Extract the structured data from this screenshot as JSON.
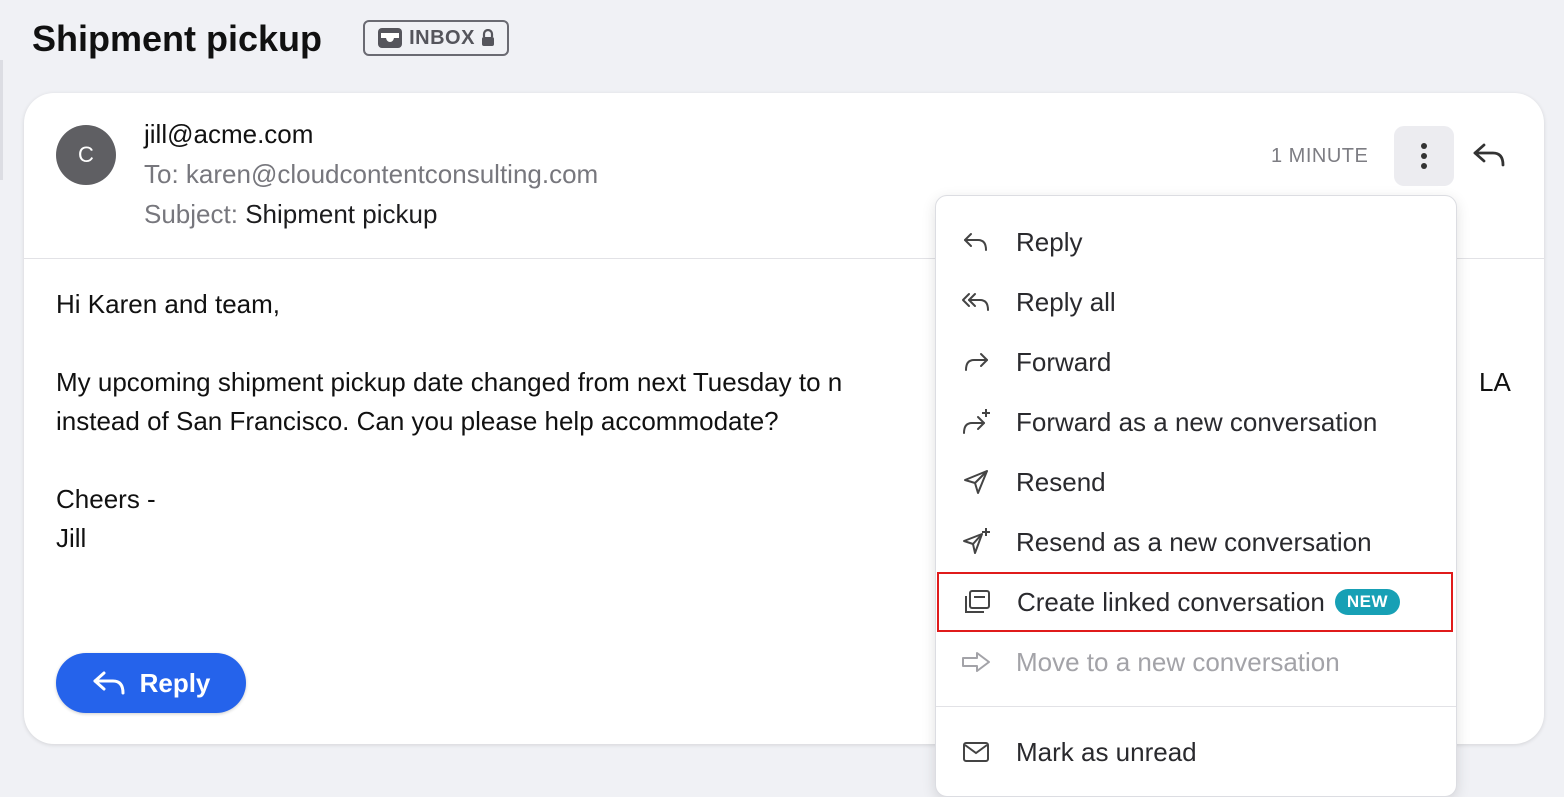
{
  "page": {
    "title": "Shipment pickup",
    "inbox_badge": "INBOX"
  },
  "message": {
    "avatar_initial": "C",
    "sender": "jill@acme.com",
    "to_label": "To:",
    "to_value": "karen@cloudcontentconsulting.com",
    "subject_label": "Subject:",
    "subject_value": "Shipment pickup",
    "timestamp": "1 MINUTE",
    "body": {
      "greeting": "Hi Karen and team,",
      "line1_part": "My upcoming shipment pickup date changed from next Tuesday to n",
      "line1_tail": "LA",
      "line2": "instead of San Francisco. Can you please help accommodate?",
      "sign1": "Cheers -",
      "sign2": "Jill"
    },
    "reply_button_label": "Reply"
  },
  "menu": {
    "items": [
      {
        "label": "Reply",
        "icon": "reply-icon"
      },
      {
        "label": "Reply all",
        "icon": "reply-all-icon"
      },
      {
        "label": "Forward",
        "icon": "forward-icon"
      },
      {
        "label": "Forward as a new conversation",
        "icon": "forward-new-icon"
      },
      {
        "label": "Resend",
        "icon": "send-icon"
      },
      {
        "label": "Resend as a new conversation",
        "icon": "send-new-icon"
      },
      {
        "label": "Create linked conversation",
        "icon": "linked-conversation-icon",
        "badge": "NEW",
        "highlighted": true
      },
      {
        "label": "Move to a new conversation",
        "icon": "move-arrow-icon",
        "disabled": true
      },
      {
        "label": "Mark as unread",
        "icon": "envelope-icon"
      }
    ]
  },
  "colors": {
    "primary": "#2563eb",
    "badge_teal": "#17a0b5",
    "highlight_red": "#e01b1b"
  }
}
